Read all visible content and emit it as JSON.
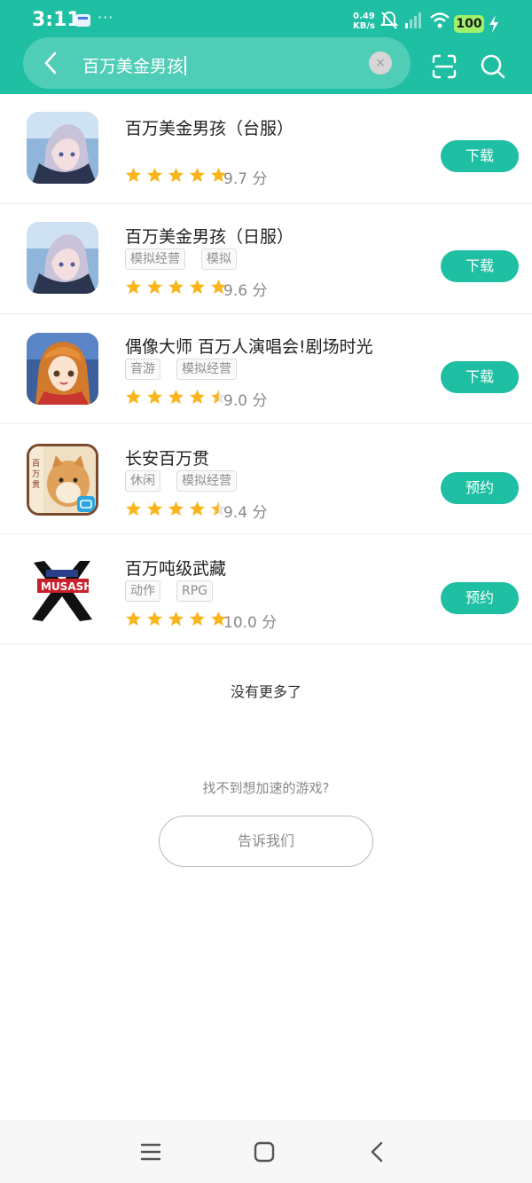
{
  "status_bar": {
    "time": "3:11",
    "more": "···",
    "speed_value": "0.49",
    "speed_unit": "KB/s",
    "battery": "100",
    "icons": [
      "mail-notification-icon",
      "mute-icon",
      "signal-icon",
      "wifi-icon",
      "charging-icon"
    ]
  },
  "search": {
    "query": "百万美金男孩",
    "clear_icon": "×"
  },
  "results": [
    {
      "name": "百万美金男孩（台服）",
      "tags": [],
      "rating": 5,
      "score": "9.7 分",
      "action": "下载",
      "icon": "anime-character-icon"
    },
    {
      "name": "百万美金男孩（日服）",
      "tags": [
        "模拟经营",
        "模拟"
      ],
      "rating": 5,
      "score": "9.6 分",
      "action": "下载",
      "icon": "anime-character-icon"
    },
    {
      "name": "偶像大师 百万人演唱会!剧场时光",
      "tags": [
        "音游",
        "模拟经营"
      ],
      "rating": 4.5,
      "score": "9.0 分",
      "action": "下载",
      "icon": "idol-girl-icon"
    },
    {
      "name": "长安百万贯",
      "tags": [
        "休闲",
        "模拟经营"
      ],
      "rating": 4.5,
      "score": "9.4 分",
      "action": "预约",
      "icon": "cat-game-icon"
    },
    {
      "name": "百万吨级武藏",
      "tags": [
        "动作",
        "RPG"
      ],
      "rating": 5,
      "score": "10.0 分",
      "action": "预约",
      "icon": "musashi-logo-icon"
    }
  ],
  "footer": {
    "no_more": "没有更多了",
    "cant_find": "找不到想加速的游戏?",
    "tell_us": "告诉我们"
  },
  "colors": {
    "accent": "#1fbfa3",
    "star": "#f9b51b"
  }
}
